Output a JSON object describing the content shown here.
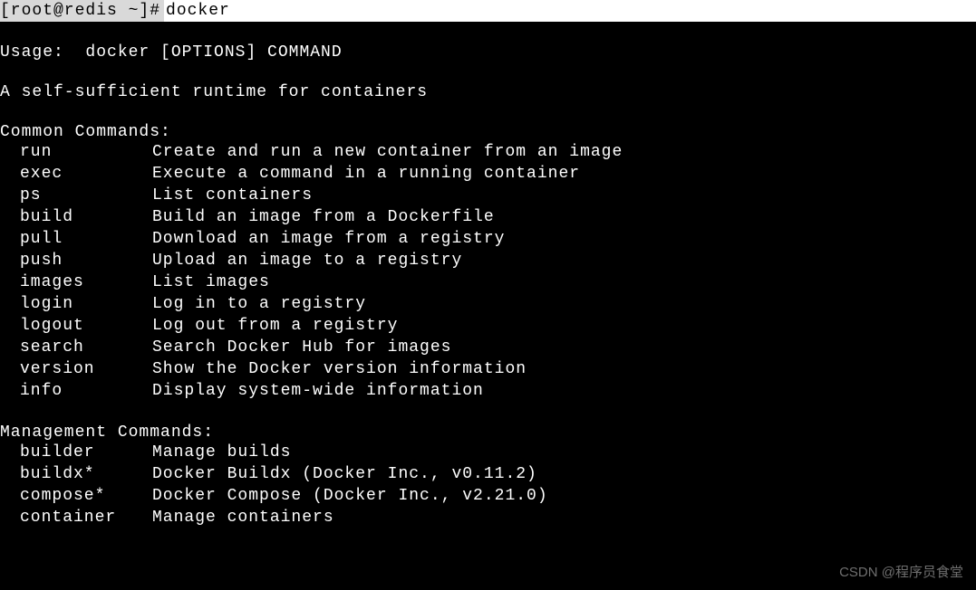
{
  "prompt": {
    "prefix": "[root@redis ~]# ",
    "command": "docker"
  },
  "usage_line": "Usage:  docker [OPTIONS] COMMAND",
  "description": "A self-sufficient runtime for containers",
  "common_header": "Common Commands:",
  "common_commands": [
    {
      "name": "run",
      "desc": "Create and run a new container from an image"
    },
    {
      "name": "exec",
      "desc": "Execute a command in a running container"
    },
    {
      "name": "ps",
      "desc": "List containers"
    },
    {
      "name": "build",
      "desc": "Build an image from a Dockerfile"
    },
    {
      "name": "pull",
      "desc": "Download an image from a registry"
    },
    {
      "name": "push",
      "desc": "Upload an image to a registry"
    },
    {
      "name": "images",
      "desc": "List images"
    },
    {
      "name": "login",
      "desc": "Log in to a registry"
    },
    {
      "name": "logout",
      "desc": "Log out from a registry"
    },
    {
      "name": "search",
      "desc": "Search Docker Hub for images"
    },
    {
      "name": "version",
      "desc": "Show the Docker version information"
    },
    {
      "name": "info",
      "desc": "Display system-wide information"
    }
  ],
  "management_header": "Management Commands:",
  "management_commands": [
    {
      "name": "builder",
      "desc": "Manage builds"
    },
    {
      "name": "buildx*",
      "desc": "Docker Buildx (Docker Inc., v0.11.2)"
    },
    {
      "name": "compose*",
      "desc": "Docker Compose (Docker Inc., v2.21.0)"
    },
    {
      "name": "container",
      "desc": "Manage containers"
    }
  ],
  "watermark": "CSDN @程序员食堂"
}
